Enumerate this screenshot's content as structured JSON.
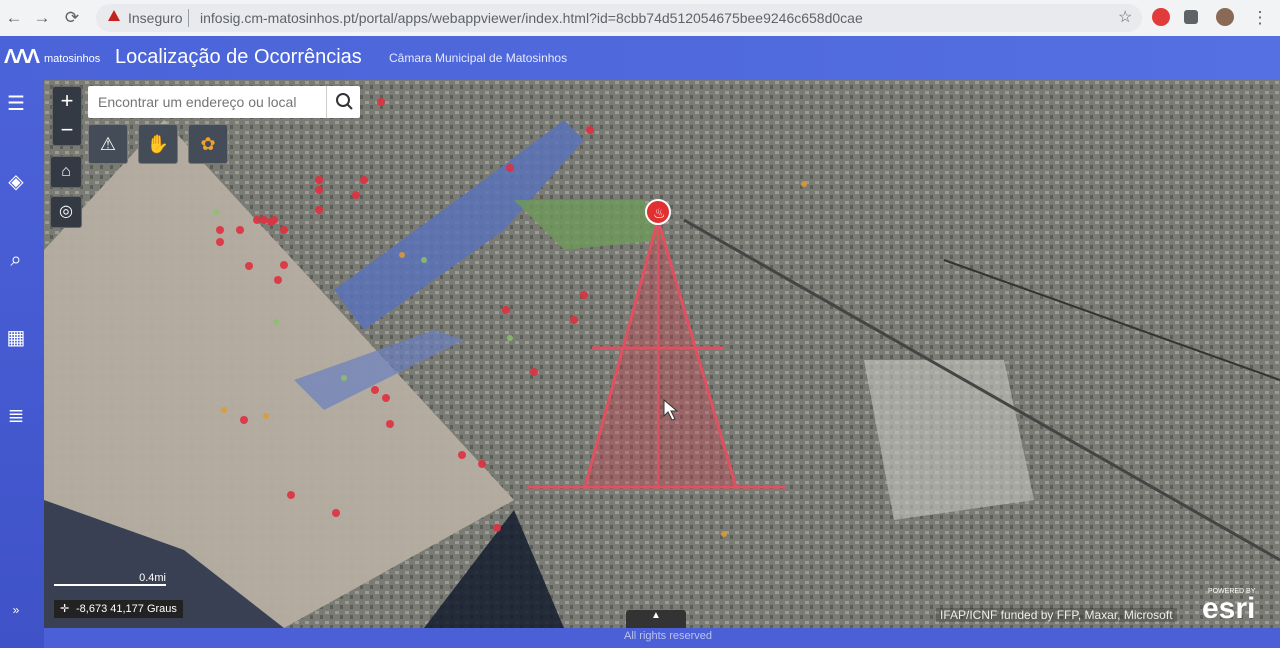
{
  "browser": {
    "security_label": "Inseguro",
    "url": "infosig.cm-matosinhos.pt/portal/apps/webappviewer/index.html?id=8cbb74d512054675bee9246c658d0cae"
  },
  "app": {
    "logo_text": "matosinhos",
    "title": "Localização de Ocorrências",
    "subtitle": "Câmara Municipal de Matosinhos"
  },
  "map": {
    "search_placeholder": "Encontrar um endereço ou local",
    "scale_label": "0.4mi",
    "coordinates": "-8,673 41,177 Graus",
    "attribution": "IFAP/ICNF funded by FFP, Maxar, Microsoft",
    "esri_powered": "POWERED BY",
    "esri_brand": "esri",
    "rights": "All rights reserved"
  }
}
